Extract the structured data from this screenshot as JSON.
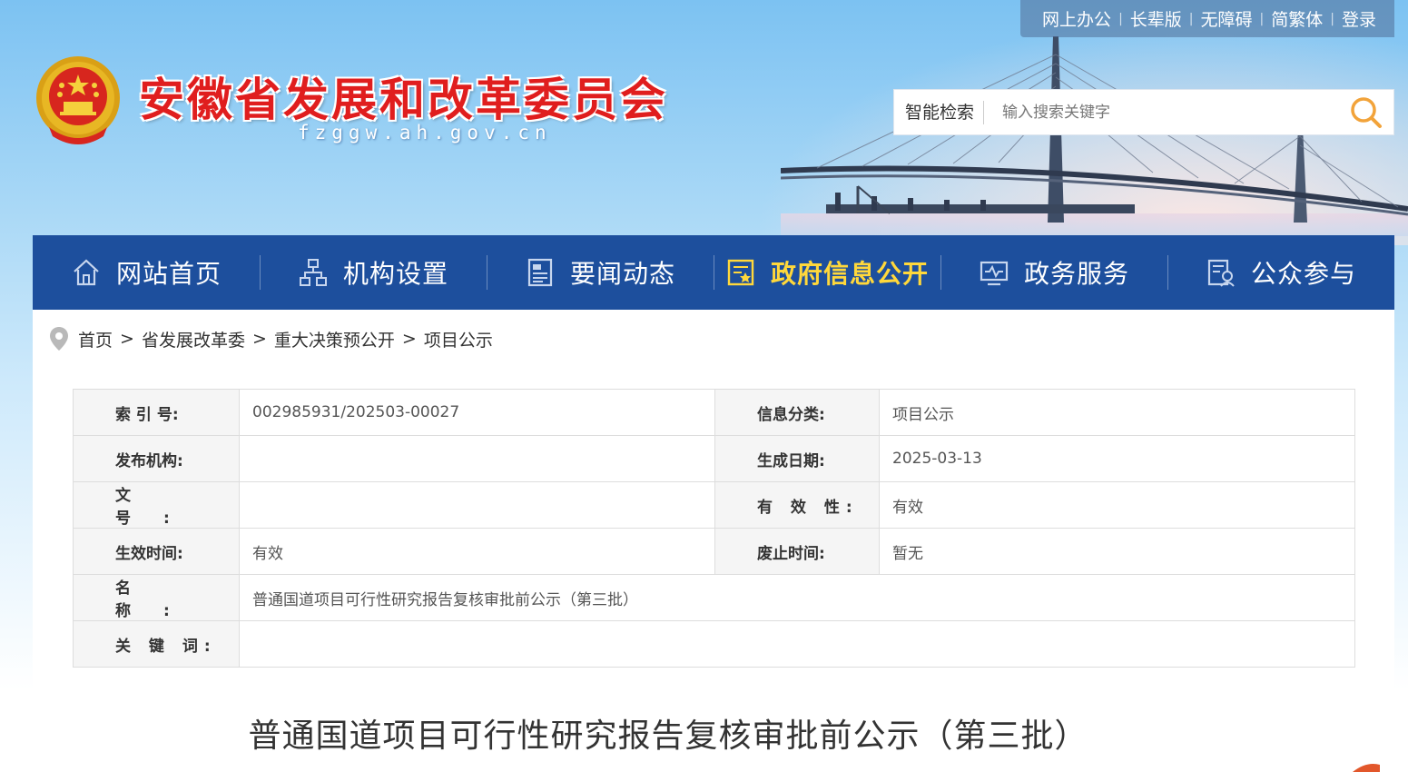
{
  "header": {
    "site_title": "安徽省发展和改革委员会",
    "site_domain": "fzggw.ah.gov.cn",
    "top_links": [
      "网上办公",
      "长辈版",
      "无障碍",
      "简繁体",
      "登录"
    ],
    "search": {
      "label": "智能检索",
      "placeholder": "输入搜索关键字"
    }
  },
  "nav": {
    "items": [
      {
        "label": "网站首页",
        "icon": "home-icon"
      },
      {
        "label": "机构设置",
        "icon": "org-chart-icon"
      },
      {
        "label": "要闻动态",
        "icon": "news-icon"
      },
      {
        "label": "政府信息公开",
        "icon": "gov-info-icon",
        "active": true
      },
      {
        "label": "政务服务",
        "icon": "service-monitor-icon"
      },
      {
        "label": "公众参与",
        "icon": "public-participation-icon"
      }
    ],
    "active_color": "#ffd83b",
    "bar_color": "#1d4f9d"
  },
  "breadcrumb": {
    "items": [
      "首页",
      "省发展改革委",
      "重大决策预公开",
      "项目公示"
    ],
    "separator": ">"
  },
  "info": {
    "index_label": "索 引 号:",
    "index_value": "002985931/202503-00027",
    "category_label": "信息分类:",
    "category_value": "项目公示",
    "publisher_label": "发布机构:",
    "publisher_value": "",
    "date_label": "生成日期:",
    "date_value": "2025-03-13",
    "docno_label": "文 号:",
    "docno_value": "",
    "validity_label": "有 效 性:",
    "validity_value": "有效",
    "effective_label": "生效时间:",
    "effective_value": "有效",
    "abolish_label": "废止时间:",
    "abolish_value": "暂无",
    "name_label": "名 称:",
    "name_value": "普通国道项目可行性研究报告复核审批前公示（第三批）",
    "keywords_label": "关 键 词:",
    "keywords_value": ""
  },
  "article": {
    "title": "普通国道项目可行性研究报告复核审批前公示（第三批）"
  }
}
